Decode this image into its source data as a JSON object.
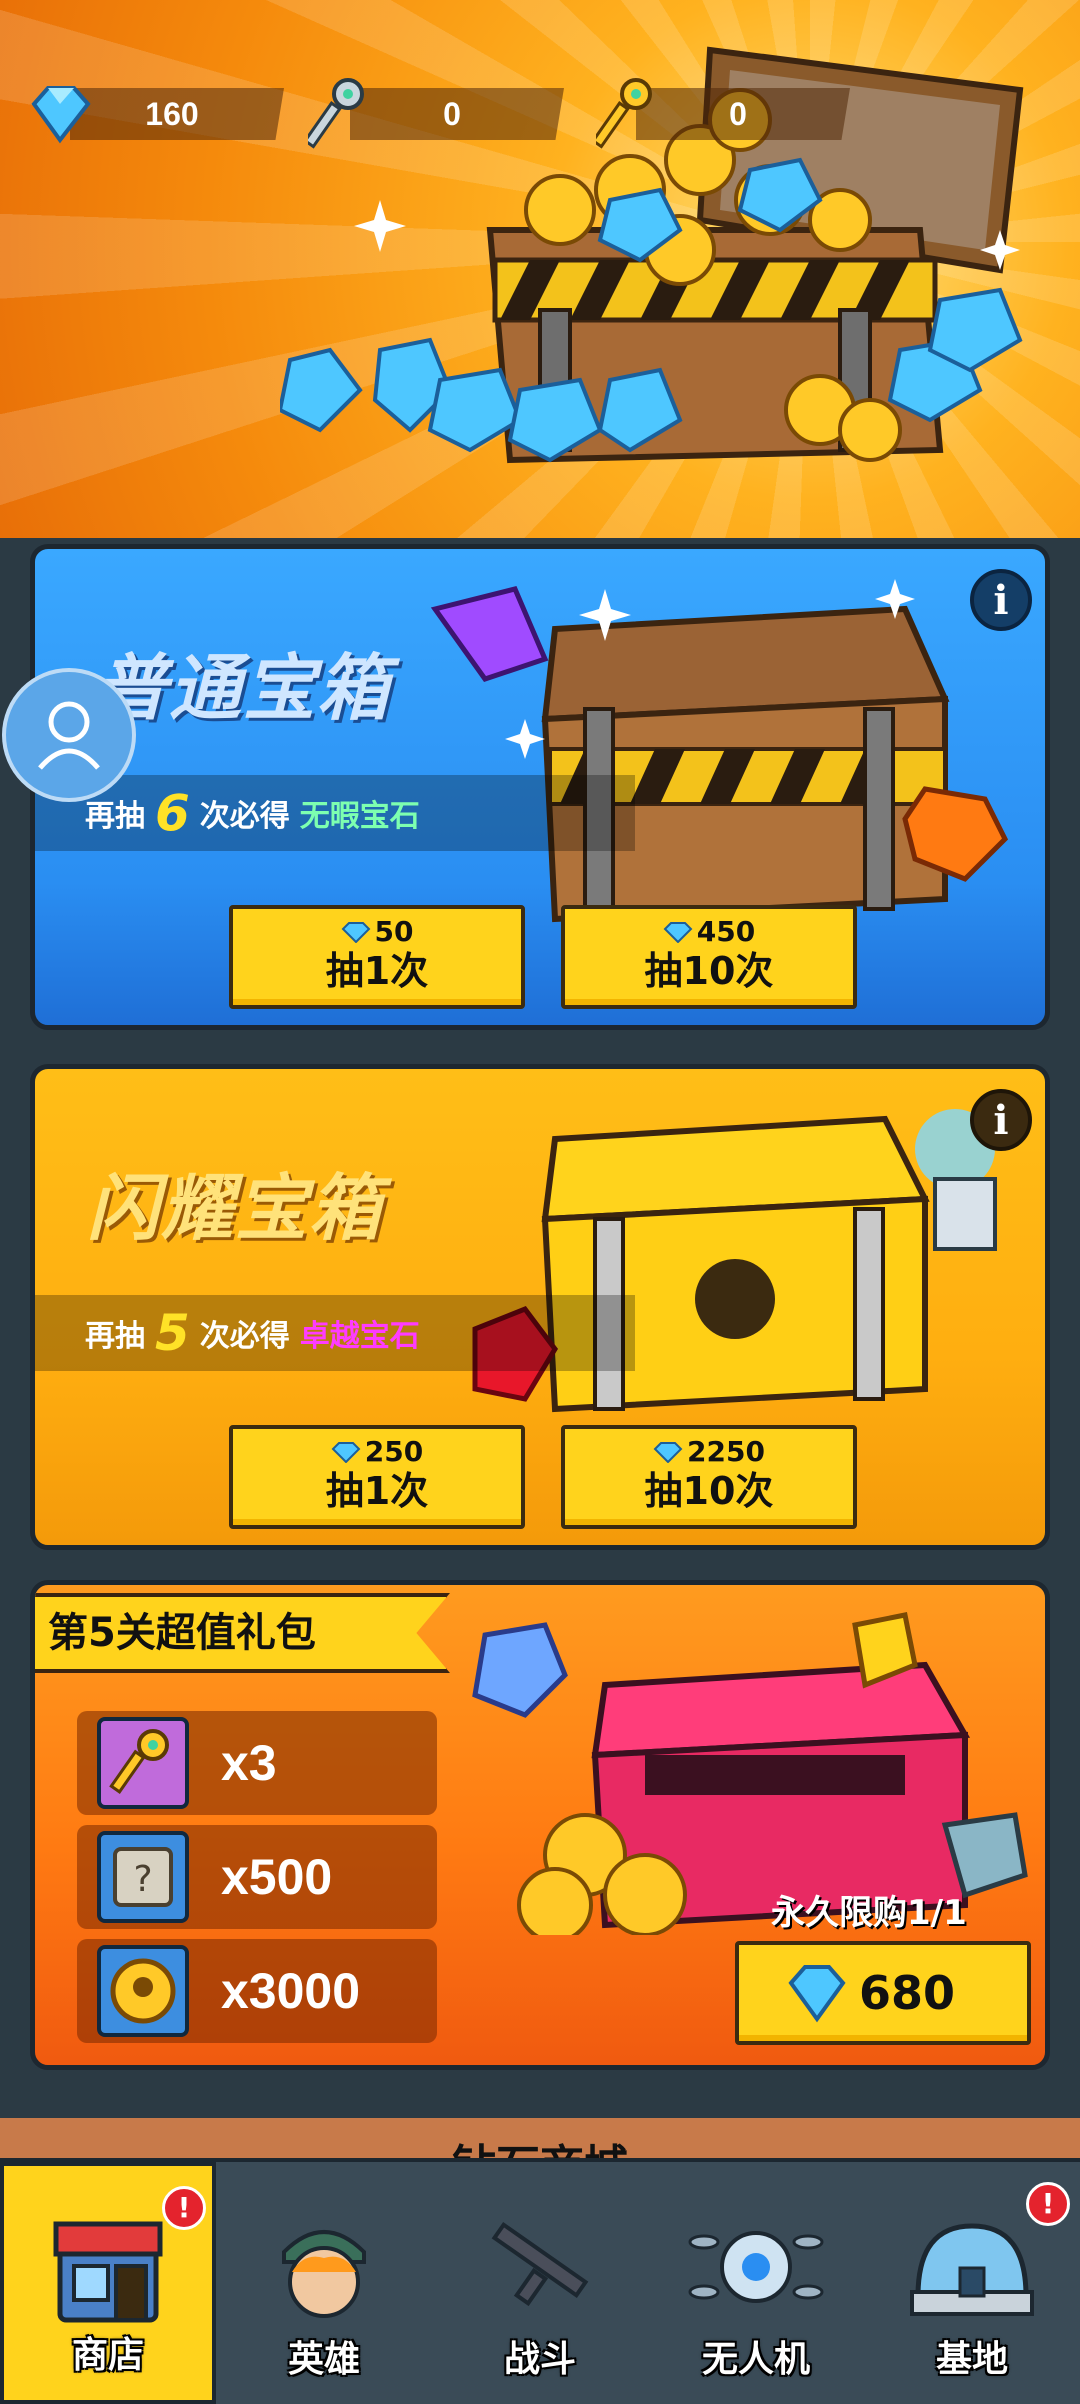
{
  "currencies": [
    {
      "icon": "diamond-icon",
      "value": "160"
    },
    {
      "icon": "silver-key-icon",
      "value": "0"
    },
    {
      "icon": "gold-key-icon",
      "value": "0"
    }
  ],
  "chests": [
    {
      "title": "普通宝箱",
      "pity_prefix": "再抽",
      "pity_count": "6",
      "pity_mid": "次必得",
      "pity_reward": "无暇宝石",
      "pity_reward_color": "#7dffb0",
      "draw_single": {
        "cost": "50",
        "label": "抽1次"
      },
      "draw_ten": {
        "cost": "450",
        "label": "抽10次"
      }
    },
    {
      "title": "闪耀宝箱",
      "pity_prefix": "再抽",
      "pity_count": "5",
      "pity_mid": "次必得",
      "pity_reward": "卓越宝石",
      "pity_reward_color": "#ff3bff",
      "draw_single": {
        "cost": "250",
        "label": "抽1次"
      },
      "draw_ten": {
        "cost": "2250",
        "label": "抽10次"
      }
    }
  ],
  "gift_pack": {
    "title": "第5关超值礼包",
    "items": [
      {
        "icon": "gold-key-icon",
        "qty": "x3"
      },
      {
        "icon": "scroll-icon",
        "qty": "x500"
      },
      {
        "icon": "coin-icon",
        "qty": "x3000"
      }
    ],
    "limit": "永久限购1/1",
    "price": "680"
  },
  "next_section_title": "钻石商城",
  "nav": [
    {
      "label": "商店",
      "icon": "shop-icon",
      "badge": "!",
      "active": true
    },
    {
      "label": "英雄",
      "icon": "hero-icon",
      "badge": "",
      "active": false
    },
    {
      "label": "战斗",
      "icon": "rifle-icon",
      "badge": "",
      "active": false
    },
    {
      "label": "无人机",
      "icon": "drone-icon",
      "badge": "",
      "active": false
    },
    {
      "label": "基地",
      "icon": "base-icon",
      "badge": "!",
      "active": false
    }
  ],
  "colors": {
    "accent": "#ffd31c",
    "blue_panel": "#2a8ef2",
    "gold_panel": "#ffae10",
    "orange_panel": "#ff7a12"
  }
}
